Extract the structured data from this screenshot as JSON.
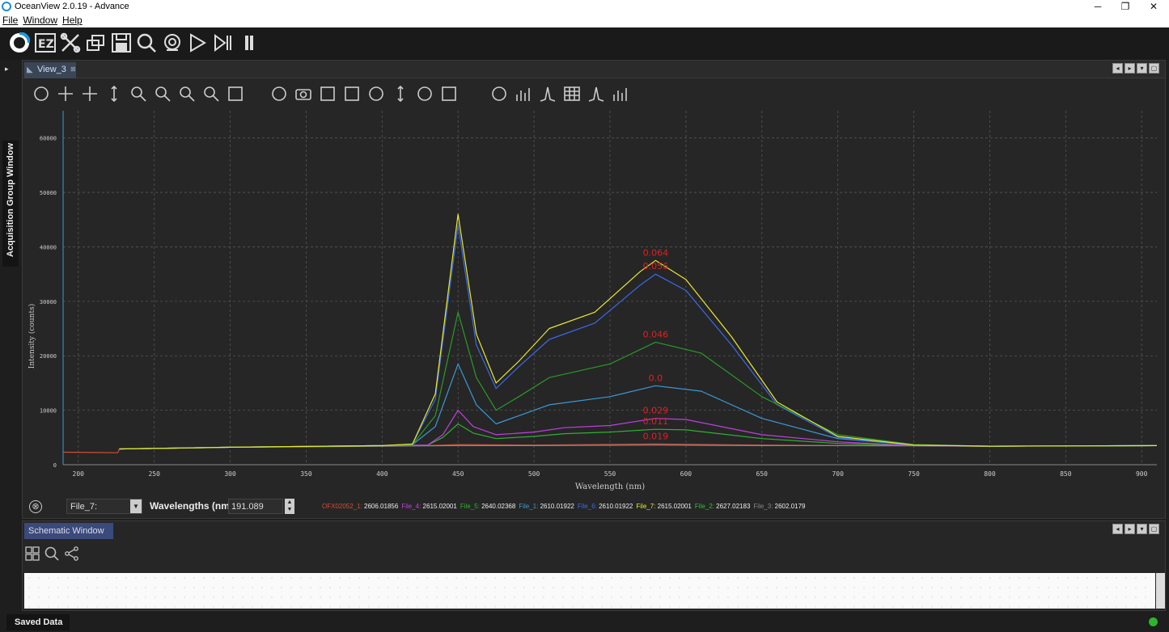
{
  "window": {
    "title": "OceanView 2.0.19 - Advance",
    "minimize": "─",
    "restore": "❐",
    "close": "✕"
  },
  "menu": [
    "File",
    "Window",
    "Help"
  ],
  "main_toolbar_icons": [
    "oceanview-logo-icon",
    "ez-mode-icon",
    "tools-icon",
    "schematic-icon",
    "save-icon",
    "search-icon",
    "spectrometer-icon",
    "play-icon",
    "step-icon",
    "pause-icon"
  ],
  "side": {
    "acquisition_label": "Acquisition Group Window",
    "pin_glyph": "▸"
  },
  "view": {
    "tab_label": "View_3",
    "tab_close": "⊠"
  },
  "graph_toolbar_icons": [
    "autoscale-icon",
    "pan-icon",
    "crosshair-icon",
    "vertical-scale-icon",
    "zoom-region-icon",
    "zoom-in-icon",
    "zoom-out-icon",
    "zoom-reset-icon",
    "hand-icon",
    "rescale-icon",
    "snapshot-icon",
    "delete-overlay-icon",
    "export-icon",
    "undo-icon",
    "overlay-icon",
    "peak-icon",
    "print-icon",
    "auto-graph-icon",
    "chart-icon",
    "peak-finder-icon",
    "table-icon",
    "spectrum-icon",
    "overlays-icon"
  ],
  "chart_data": {
    "type": "line",
    "xlabel": "Wavelength (nm)",
    "ylabel": "Intensity (counts)",
    "xlim": [
      190,
      910
    ],
    "ylim": [
      0,
      65000
    ],
    "xticks": [
      200,
      250,
      300,
      350,
      400,
      450,
      500,
      550,
      600,
      650,
      700,
      750,
      800,
      850,
      900
    ],
    "yticks": [
      0,
      10000,
      20000,
      30000,
      40000,
      50000,
      60000
    ],
    "grid": true,
    "series": [
      {
        "name": "OFX02052_1",
        "color": "#d64c34",
        "x": [
          190,
          226,
          227,
          300,
          400,
          430,
          450,
          500,
          580,
          650,
          700,
          750,
          800,
          910
        ],
        "y": [
          2300,
          2200,
          2900,
          3200,
          3500,
          3500,
          3700,
          3600,
          3800,
          3600,
          3500,
          3500,
          3400,
          3500
        ],
        "label": "0.019"
      },
      {
        "name": "File_4",
        "color": "#c040e0",
        "x": [
          227,
          300,
          400,
          430,
          440,
          450,
          460,
          475,
          500,
          520,
          550,
          580,
          600,
          650,
          700,
          750,
          800,
          910
        ],
        "y": [
          2900,
          3200,
          3500,
          3600,
          5500,
          10000,
          7000,
          5500,
          6000,
          6800,
          7200,
          8500,
          8300,
          5500,
          4200,
          3500,
          3400,
          3500
        ],
        "label": "0.029"
      },
      {
        "name": "File_5",
        "color": "#30b030",
        "x": [
          227,
          300,
          400,
          430,
          440,
          450,
          460,
          475,
          500,
          520,
          550,
          580,
          600,
          650,
          700,
          750,
          800,
          910
        ],
        "y": [
          2900,
          3200,
          3500,
          3600,
          5000,
          7500,
          5800,
          4800,
          5200,
          5700,
          6000,
          6500,
          6400,
          4800,
          3900,
          3500,
          3400,
          3500
        ],
        "label": "0.011"
      },
      {
        "name": "File_1",
        "color": "#3a9ad6",
        "x": [
          227,
          300,
          400,
          420,
          435,
          450,
          462,
          475,
          490,
          510,
          550,
          580,
          610,
          650,
          700,
          750,
          800,
          910
        ],
        "y": [
          2900,
          3200,
          3500,
          3700,
          7000,
          18500,
          11000,
          7500,
          9000,
          11000,
          12500,
          14500,
          13500,
          8500,
          4800,
          3600,
          3400,
          3500
        ],
        "label": "0.0"
      },
      {
        "name": "File_6",
        "color": "#3a6ae8",
        "x": [
          227,
          300,
          400,
          420,
          435,
          450,
          462,
          475,
          490,
          510,
          540,
          570,
          580,
          600,
          630,
          660,
          700,
          750,
          800,
          910
        ],
        "y": [
          2900,
          3200,
          3500,
          3800,
          12000,
          44000,
          22000,
          14000,
          18000,
          23000,
          26000,
          33000,
          35000,
          32000,
          22000,
          11000,
          5000,
          3600,
          3400,
          3500
        ],
        "label": "0.056"
      },
      {
        "name": "File_7",
        "color": "#e8e830",
        "x": [
          227,
          300,
          400,
          420,
          435,
          450,
          462,
          475,
          490,
          510,
          540,
          570,
          580,
          600,
          630,
          660,
          700,
          750,
          800,
          910
        ],
        "y": [
          2900,
          3200,
          3500,
          3800,
          13000,
          46000,
          24000,
          15000,
          19000,
          25000,
          28000,
          35500,
          37500,
          34000,
          23500,
          11500,
          5200,
          3600,
          3400,
          3500
        ],
        "label": "0.064"
      },
      {
        "name": "File_2",
        "color": "#2a9a2a",
        "x": [
          227,
          300,
          400,
          420,
          435,
          450,
          462,
          475,
          490,
          510,
          550,
          580,
          610,
          650,
          700,
          750,
          800,
          910
        ],
        "y": [
          2900,
          3200,
          3500,
          3700,
          9000,
          28000,
          16000,
          10000,
          12500,
          16000,
          18500,
          22500,
          20500,
          12500,
          5500,
          3700,
          3400,
          3500
        ],
        "label": "0.046"
      },
      {
        "name": "File_3",
        "color": "#888888",
        "x": [
          227,
          300,
          400,
          450,
          500,
          580,
          650,
          700,
          800,
          910
        ],
        "y": [
          2900,
          3200,
          3400,
          3500,
          3500,
          3600,
          3500,
          3500,
          3400,
          3500
        ],
        "label": ""
      }
    ]
  },
  "status": {
    "clear_glyph": "⊗",
    "file_select": "File_7:",
    "dropdown_glyph": "▼",
    "wavelength_label": "Wavelengths (nm)",
    "wavelength_value": "191.089",
    "spin_glyph": "▲▼",
    "legend": [
      {
        "name": "OFX02052_1:",
        "value": "2606.01856",
        "color": "#d64c34"
      },
      {
        "name": "File_4:",
        "value": "2615.02001",
        "color": "#c040e0"
      },
      {
        "name": "File_5:",
        "value": "2640.02368",
        "color": "#30b030"
      },
      {
        "name": "File_1:",
        "value": "2610.01922",
        "color": "#3a9ad6"
      },
      {
        "name": "File_6:",
        "value": "2610.01922",
        "color": "#3a6ae8"
      },
      {
        "name": "File_7:",
        "value": "2615.02001",
        "color": "#e8e830"
      },
      {
        "name": "File_2:",
        "value": "2627.02183",
        "color": "#30c030"
      },
      {
        "name": "File_3:",
        "value": "2602.0179",
        "color": "#888888"
      }
    ]
  },
  "schematic": {
    "tab_label": "Schematic Window",
    "tool_icons": [
      "layout-grid-icon",
      "schematic-search-icon",
      "connect-icon"
    ]
  },
  "saved": {
    "tab_label": "Saved Data"
  },
  "panel_controls": [
    "◂",
    "▸",
    "▾",
    "▢"
  ]
}
